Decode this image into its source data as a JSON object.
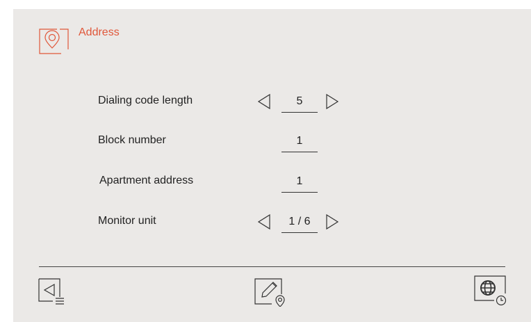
{
  "header": {
    "title": "Address",
    "icon": "location-pin-icon"
  },
  "rows": [
    {
      "label": "Dialing code length",
      "value": "5",
      "has_arrows": true
    },
    {
      "label": "Block number",
      "value": "1",
      "has_arrows": false
    },
    {
      "label": "Apartment address",
      "value": "1",
      "has_arrows": false
    },
    {
      "label": "Monitor unit",
      "value": "1 / 6",
      "has_arrows": true
    }
  ],
  "footer": {
    "back_icon": "back-list-icon",
    "edit_icon": "edit-location-icon",
    "settings_icon": "globe-clock-icon"
  },
  "colors": {
    "accent": "#e0573a",
    "background": "#ebe9e7",
    "text": "#222222"
  }
}
